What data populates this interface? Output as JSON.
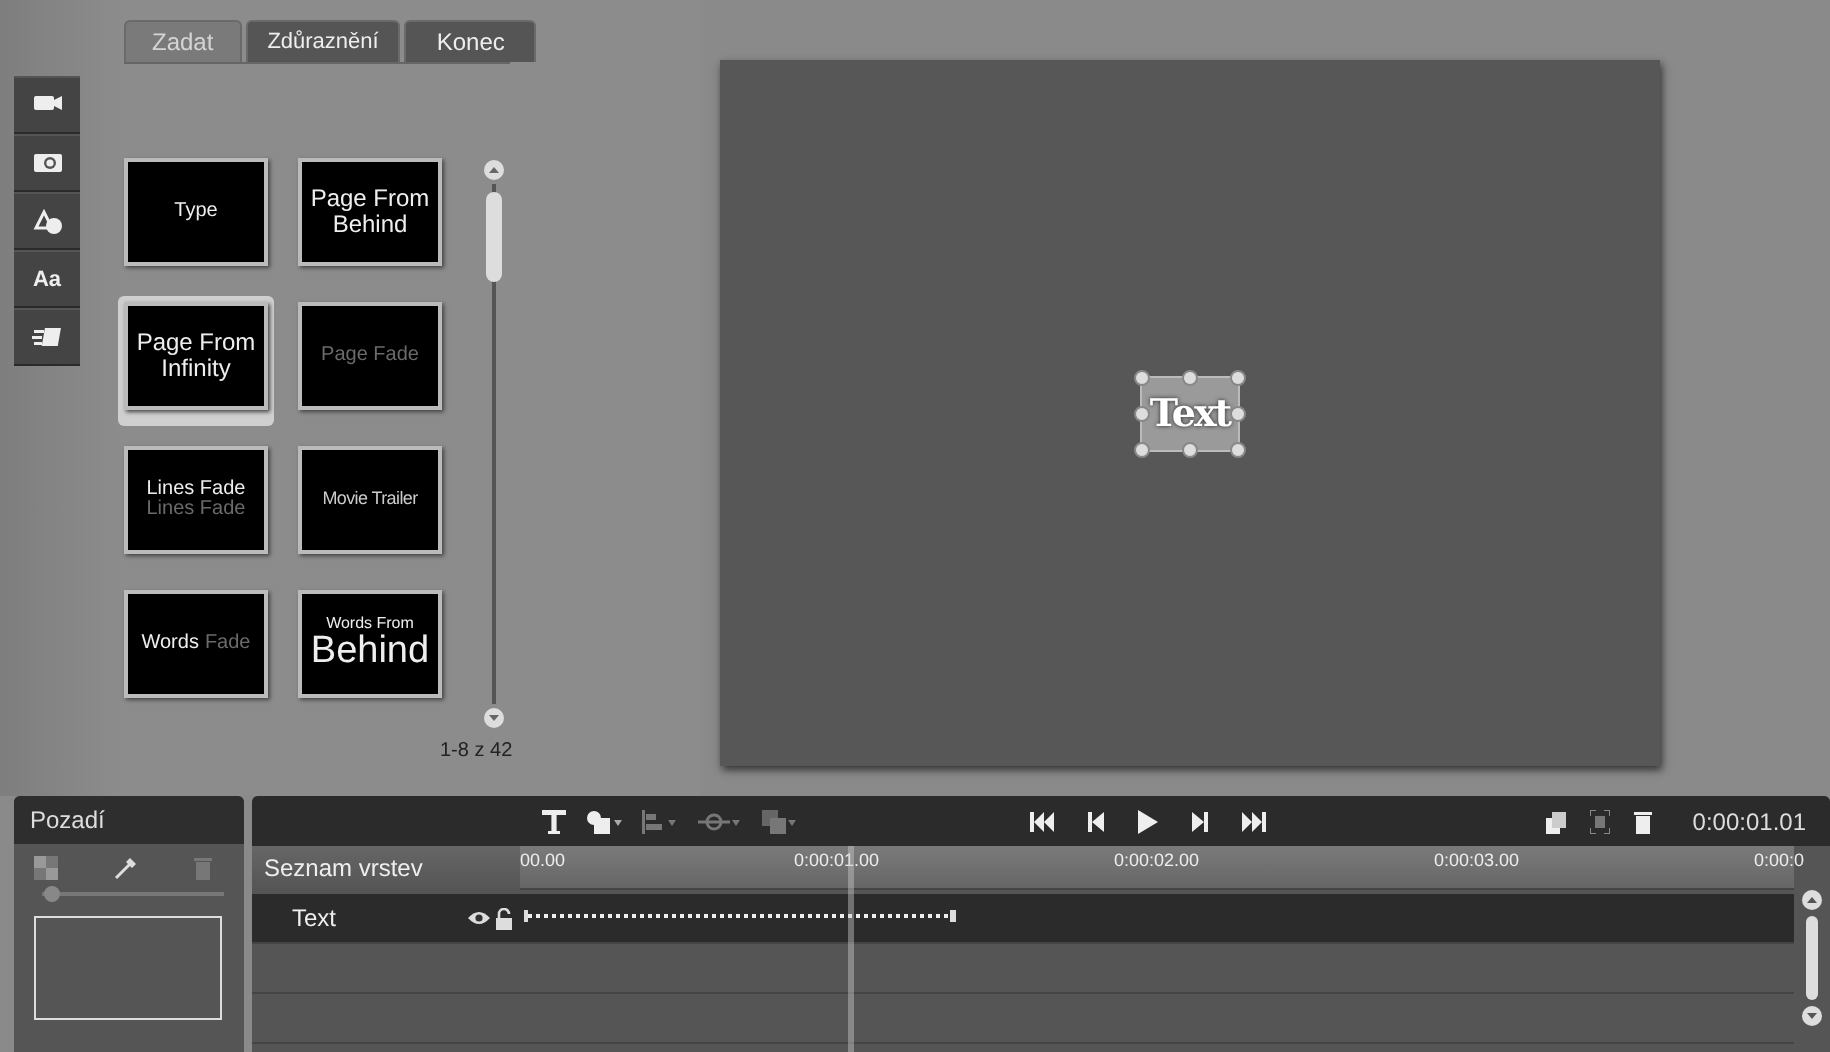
{
  "tabs": [
    {
      "label": "Zadat",
      "selected": true
    },
    {
      "label": "Zdůraznění",
      "selected": false
    },
    {
      "label": "Konec",
      "selected": false
    }
  ],
  "tool_strip": [
    {
      "kind": "video"
    },
    {
      "kind": "photo"
    },
    {
      "kind": "shapes"
    },
    {
      "kind": "text",
      "label": "Aa"
    },
    {
      "kind": "motion"
    }
  ],
  "presets": [
    {
      "selected": false,
      "lines": [
        [
          {
            "text": "Type",
            "kind": "normal"
          }
        ]
      ]
    },
    {
      "selected": false,
      "lines": [
        [
          {
            "text": "Page From",
            "kind": "large"
          }
        ],
        [
          {
            "text": "Behind",
            "kind": "large"
          }
        ]
      ]
    },
    {
      "selected": true,
      "lines": [
        [
          {
            "text": "Page From",
            "kind": "large"
          }
        ],
        [
          {
            "text": "Infinity",
            "kind": "large"
          }
        ]
      ]
    },
    {
      "selected": false,
      "lines": [
        [
          {
            "text": "Page Fade",
            "kind": "dim"
          }
        ]
      ]
    },
    {
      "selected": false,
      "lines": [
        [
          {
            "text": "Lines Fade",
            "kind": "normal"
          }
        ],
        [
          {
            "text": "Lines Fade",
            "kind": "dim"
          }
        ]
      ]
    },
    {
      "selected": false,
      "lines": [
        [
          {
            "text": "Movie Trailer",
            "kind": "light"
          }
        ]
      ]
    },
    {
      "selected": false,
      "lines": [
        [
          {
            "text": "Words",
            "kind": "normal"
          },
          {
            "text": "Fade",
            "kind": "dim"
          }
        ]
      ]
    },
    {
      "selected": false,
      "lines": [
        [
          {
            "text": "Words From",
            "kind": "small"
          }
        ],
        [
          {
            "text": "Behind",
            "kind": "big"
          }
        ]
      ]
    }
  ],
  "preset_count": "1-8 z 42",
  "preview": {
    "text_object": "Text"
  },
  "background_panel": {
    "title": "Pozadí",
    "opacity": {
      "level": 0.05
    }
  },
  "timeline": {
    "time": "0:00:01.01",
    "layer_list_title": "Seznam vrstev",
    "ruler_labels": [
      "00.00",
      "0:00:01.00",
      "0:00:02.00",
      "0:00:03.00",
      "0:00:0"
    ],
    "layers": [
      {
        "name": "Text",
        "visible": true,
        "locked": false
      }
    ]
  }
}
